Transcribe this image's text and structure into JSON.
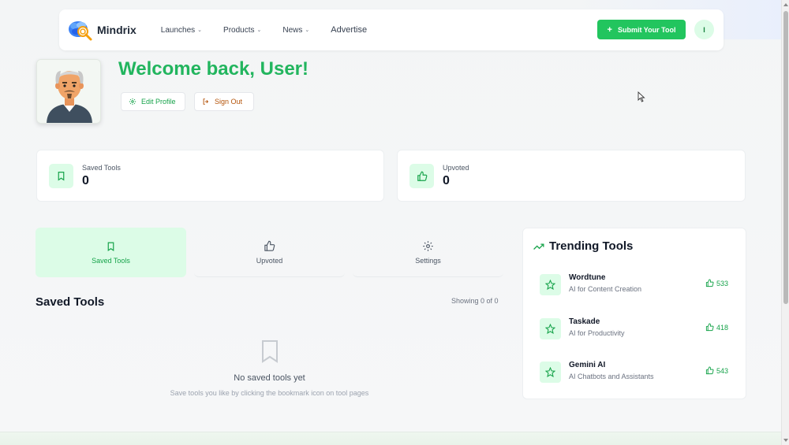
{
  "brand": {
    "name": "Mindrix"
  },
  "nav": {
    "items": [
      {
        "label": "Launches",
        "chevron": "⌄"
      },
      {
        "label": "Products",
        "chevron": "⌄"
      },
      {
        "label": "News",
        "chevron": "⌄"
      }
    ],
    "advertise": "Advertise",
    "submit_label": "Submit Your Tool",
    "user_initial": "I"
  },
  "profile": {
    "welcome": "Welcome back, User!",
    "edit_label": "Edit Profile",
    "signout_label": "Sign Out"
  },
  "stats": [
    {
      "label": "Saved Tools",
      "value": "0",
      "icon": "bookmark-icon"
    },
    {
      "label": "Upvoted",
      "value": "0",
      "icon": "thumbs-up-icon"
    }
  ],
  "tabs": [
    {
      "label": "Saved Tools",
      "icon": "bookmark-icon",
      "active": true
    },
    {
      "label": "Upvoted",
      "icon": "thumbs-up-icon",
      "active": false
    },
    {
      "label": "Settings",
      "icon": "gear-icon",
      "active": false
    }
  ],
  "saved": {
    "title": "Saved Tools",
    "showing": "Showing 0 of 0",
    "empty_title": "No saved tools yet",
    "empty_sub": "Save tools you like by clicking the bookmark icon on tool pages"
  },
  "trending": {
    "title": "Trending Tools",
    "items": [
      {
        "name": "Wordtune",
        "category": "AI for Content Creation",
        "votes": "533"
      },
      {
        "name": "Taskade",
        "category": "AI for Productivity",
        "votes": "418"
      },
      {
        "name": "Gemini AI",
        "category": "AI Chatbots and Assistants",
        "votes": "543"
      }
    ]
  },
  "colors": {
    "accent": "#22c55e",
    "accent_text": "#16a34a",
    "accent_soft": "#dcfce7",
    "signout": "#b45309"
  }
}
